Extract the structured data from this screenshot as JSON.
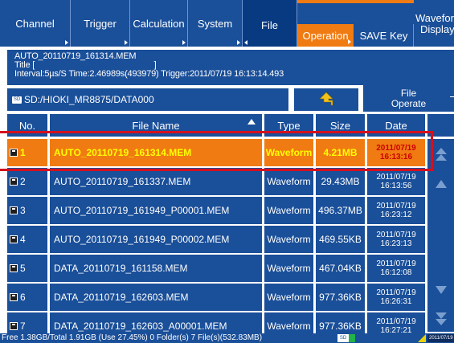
{
  "top_tabs": [
    {
      "label": "Channel"
    },
    {
      "label": "Trigger"
    },
    {
      "label": "Calculation"
    },
    {
      "label": "System"
    },
    {
      "label": "File"
    }
  ],
  "sub_tabs": {
    "operation": "Operation",
    "save_key": "SAVE Key",
    "waveform_display_1": "Wavefor",
    "waveform_display_2": "Display"
  },
  "info": {
    "line1": "AUTO_20110719_161314.MEM",
    "line2": "Title [                                                    ]",
    "line3": "Interval:5µs/S Time:2.46989s(493979) Trigger:2011/07/19 16:13:14.493"
  },
  "path": {
    "sd_icon": "SD",
    "text": "SD:/HIOKI_MR8875/DATA000"
  },
  "file_operate": {
    "line1": "File",
    "line2": "Operate"
  },
  "table": {
    "headers": {
      "no": "No.",
      "name": "File Name",
      "type": "Type",
      "size": "Size",
      "date": "Date"
    },
    "rows": [
      {
        "no": "1",
        "name": "AUTO_20110719_161314.MEM",
        "type": "Waveform",
        "size": "4.21MB",
        "date": "2011/07/19",
        "time": "16:13:16",
        "selected": true
      },
      {
        "no": "2",
        "name": "AUTO_20110719_161337.MEM",
        "type": "Waveform",
        "size": "29.43MB",
        "date": "2011/07/19",
        "time": "16:13:56",
        "selected": false
      },
      {
        "no": "3",
        "name": "AUTO_20110719_161949_P00001.MEM",
        "type": "Waveform",
        "size": "496.37MB",
        "date": "2011/07/19",
        "time": "16:23:12",
        "selected": false
      },
      {
        "no": "4",
        "name": "AUTO_20110719_161949_P00002.MEM",
        "type": "Waveform",
        "size": "469.55KB",
        "date": "2011/07/19",
        "time": "16:23:13",
        "selected": false
      },
      {
        "no": "5",
        "name": "DATA_20110719_161158.MEM",
        "type": "Waveform",
        "size": "467.04KB",
        "date": "2011/07/19",
        "time": "16:12:08",
        "selected": false
      },
      {
        "no": "6",
        "name": "DATA_20110719_162603.MEM",
        "type": "Waveform",
        "size": "977.36KB",
        "date": "2011/07/19",
        "time": "16:26:31",
        "selected": false
      },
      {
        "no": "7",
        "name": "DATA_20110719_162603_A00001.MEM",
        "type": "Waveform",
        "size": "977.36KB",
        "date": "2011/07/19",
        "time": "16:27:21",
        "selected": false
      }
    ]
  },
  "status": {
    "text": "Free 1.38GB/Total 1.91GB (Use 27.45%)  0 Folder(s) 7 File(s)(532.83MB)",
    "sd_icon": "SD",
    "date": "2011/07/19"
  },
  "colors": {
    "panel_blue": "#1a4f99",
    "accent_orange": "#f07b12",
    "selected_text": "#ffff00",
    "selected_date": "#cc0000",
    "highlight_red": "#d4101e",
    "scroll_arrow": "#7a9fcf"
  },
  "icons": {
    "up_folder": "up-arrow-icon",
    "scroll_top": "double-up-arrow-icon",
    "scroll_up": "up-arrow-icon",
    "scroll_down": "down-arrow-icon",
    "scroll_bottom": "double-down-arrow-icon",
    "file": "file-icon"
  }
}
